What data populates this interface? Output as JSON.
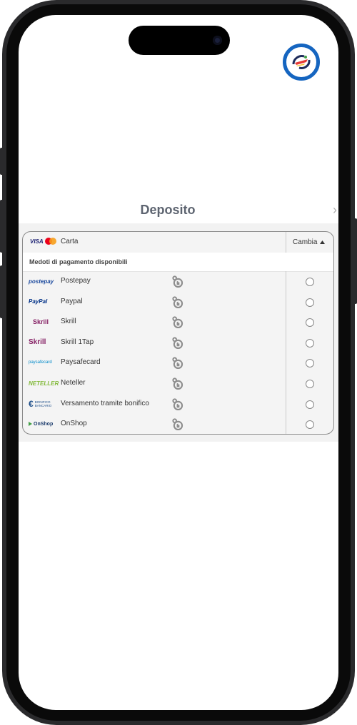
{
  "page": {
    "title": "Deposito"
  },
  "payment": {
    "selected_label": "Carta",
    "change_label": "Cambia",
    "section_title": "Medoti di pagamento disponibili",
    "methods": [
      {
        "label": "Postepay",
        "logo_text": "postepay",
        "icon": "postepay-logo"
      },
      {
        "label": "Paypal",
        "logo_text": "PayPal",
        "icon": "paypal-logo"
      },
      {
        "label": "Skrill",
        "logo_text": "Skrill",
        "icon": "skrill-logo"
      },
      {
        "label": "Skrill 1Tap",
        "logo_text": "Skrill",
        "icon": "skrill-1tap-logo"
      },
      {
        "label": "Paysafecard",
        "logo_text": "paysafecard",
        "icon": "paysafecard-logo"
      },
      {
        "label": "Neteller",
        "logo_text": "NETELLER",
        "icon": "neteller-logo"
      },
      {
        "label": "Versamento tramite bonifico",
        "logo_text": "BONIFICO BANCARIO",
        "icon": "bank-transfer-logo"
      },
      {
        "label": "OnShop",
        "logo_text": "OnShop",
        "icon": "onshop-logo"
      }
    ]
  },
  "colors": {
    "accent": "#1565c0",
    "title": "#5d6470",
    "panel": "#f2f2f2"
  }
}
